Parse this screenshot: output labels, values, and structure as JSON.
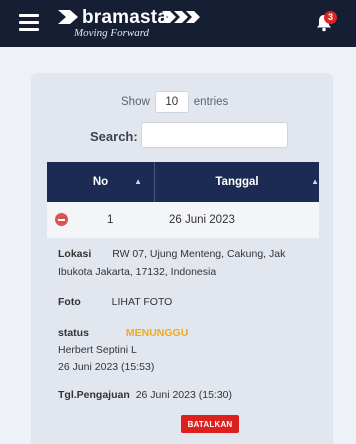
{
  "navbar": {
    "brand_name": "bramasta",
    "brand_tagline": "Moving Forward",
    "notification_count": "3"
  },
  "table_controls": {
    "show_label": "Show",
    "entries_value": "10",
    "entries_label": "entries",
    "search_label": "Search:",
    "search_value": ""
  },
  "table": {
    "columns": [
      "No",
      "Tanggal"
    ],
    "rows": [
      {
        "no": "1",
        "tanggal": "26 Juni 2023"
      }
    ]
  },
  "detail": {
    "lokasi_label": "Lokasi",
    "lokasi_line1": "RW 07, Ujung Menteng, Cakung, Jak",
    "lokasi_line2": "Ibukota Jakarta, 17132, Indonesia",
    "foto_label": "Foto",
    "foto_link": "LIHAT FOTO",
    "status_label": "status",
    "status_value": "MENUNGGU",
    "status_by": "Herbert Septini L",
    "status_time": "26 Juni 2023 (15:53)",
    "pengajuan_label": "Tgl.Pengajuan",
    "pengajuan_value": "26 Juni 2023 (15:30)",
    "cancel_button": "BATALKAN"
  },
  "colors": {
    "navbar": "#161e33",
    "table_header": "#1c2b54",
    "status_waiting": "#f0a91c",
    "danger": "#dc1f1f"
  }
}
